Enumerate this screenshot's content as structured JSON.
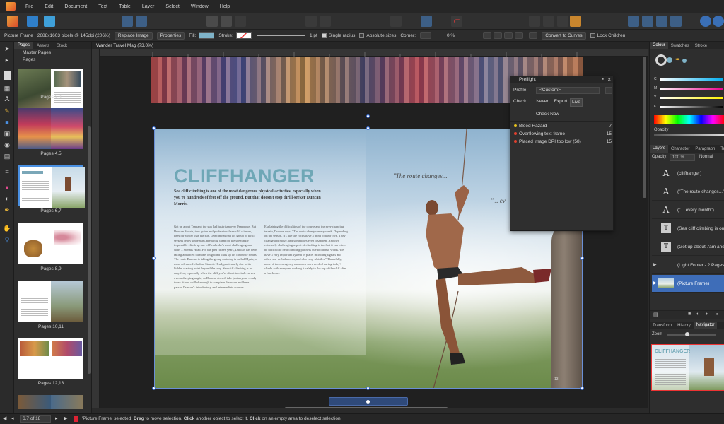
{
  "menu": [
    "File",
    "Edit",
    "Document",
    "Text",
    "Table",
    "Layer",
    "Select",
    "Window",
    "Help"
  ],
  "context_bar": {
    "selection_type": "Picture Frame",
    "image_info": "2688x1603 pixels @ 145dpi (206%)",
    "replace_image": "Replace Image",
    "properties": "Properties",
    "fill_label": "Fill:",
    "stroke_label": "Stroke:",
    "stroke_width": "1 pt",
    "single_radius": "Single radius",
    "absolute_sizes": "Absolute sizes",
    "corner_label": "Corner:",
    "corner_value": "0 %",
    "convert_to_curves": "Convert to Curves",
    "lock_children": "Lock Children",
    "fill_color": "#7fb3c8"
  },
  "pages_panel": {
    "tabs": [
      "Pages",
      "Assets",
      "Stock"
    ],
    "active_tab": "Pages",
    "master_pages": "Master Pages",
    "pages_section": "Pages",
    "spreads": [
      {
        "label": "Pages 2,3"
      },
      {
        "label": "Pages 4,5"
      },
      {
        "label": "Pages 6,7"
      },
      {
        "label": "Pages 8,9"
      },
      {
        "label": "Pages 10,11"
      },
      {
        "label": "Pages 12,13"
      }
    ]
  },
  "document": {
    "tab_title": "Wander Travel Mag (73.0%)",
    "headline": "CLIFFHANGER",
    "intro": "Sea cliff climbing is one of the most dangerous physical activities, especially when you're hundreds of feet off the ground. But that doesn't stop thrill-seeker Duncan Morris.",
    "quote1": "\"The route changes...",
    "quote2": "\"... ev",
    "body_col1": "Get up about 7am and the sun had just risen over Pembroke. But Duncan Morris, tour guide and professional sea cliff climber, rises far earlier than the sun. Duncan has had his group of thrill seekers ready since 6am, preparing them for the seemingly impossible climb up one of Pembroke's most challenging sea cliffs – Stennis Head. For the past fifteen years, Duncan has been taking advanced climbers on guided tours up his favourite routes. The route Duncan is taking the group on today is called Mysta, a more advanced climb at Stennis Head, particularly due to its hidden starting point beyond the crag. Sea cliff climbing is no easy feat, especially when the cliff you're about to climb curves over a dizzying angle, so Duncan doesn't take just anyone – only those fit and skilled enough to complete the route and have passed Duncan's introductory and intermediate courses.",
    "body_col2": "Explaining the difficulties of the course and the ever-changing terrain, Duncan says: \"The route changes every week. Depending on the season, it's like the rocks have a mind of their own. They change and move, and sometimes even disappear. Another extremely challenging aspect of climbing is the fact it can often be difficult to hear climbing partners due to intense winds. We have a very important system in place, including signals and other non-verbal moves, and also easy whistles.\" Thankfully, none of the emergency measures were needed during today's climb, with everyone making it safely to the top of the cliff after a few hours.",
    "page_num": "13"
  },
  "preflight": {
    "title": "Preflight",
    "profile_label": "Profile:",
    "profile_value": "<Custom>",
    "check_label": "Check:",
    "check_options": [
      "Never",
      "Export",
      "Live"
    ],
    "check_now": "Check Now",
    "items": [
      {
        "label": "Bleed Hazard",
        "count": "7",
        "color": "#e6c21d"
      },
      {
        "label": "Overflowing text frame",
        "count": "15",
        "color": "#e0402e"
      },
      {
        "label": "Placed image DPI too low (58)",
        "count": "15",
        "color": "#e0402e"
      }
    ]
  },
  "color_panel": {
    "tabs": [
      "Colour",
      "Swatches",
      "Stroke"
    ],
    "active_tab": "Colour",
    "opacity_label": "Opacity",
    "channels": [
      "C",
      "M",
      "Y",
      "K"
    ]
  },
  "layers_panel": {
    "tabs": [
      "Layers",
      "Character",
      "Paragraph",
      "Te"
    ],
    "active_tab": "Layers",
    "opacity_label": "Opacity:",
    "opacity_value": "100 %",
    "blend_mode": "Normal",
    "layers": [
      {
        "name": "(cliffhanger)",
        "icon": "A"
      },
      {
        "name": "(\"The route changes...\")",
        "icon": "A"
      },
      {
        "name": "(\"... every month\")",
        "icon": "A"
      },
      {
        "name": "(Sea cliff climbing is one",
        "icon": "T"
      },
      {
        "name": "(Get up about 7am and",
        "icon": "T"
      },
      {
        "name": "(Light Footer - 2 Pages)",
        "icon": ""
      },
      {
        "name": "(Picture Frame)",
        "icon": "img"
      }
    ]
  },
  "navigator_panel": {
    "tabs": [
      "Transform",
      "History",
      "Navigator"
    ],
    "active_tab": "Navigator",
    "zoom_label": "Zoom",
    "thumb_title": "CLIFFHANGER"
  },
  "status_bar": {
    "page_indicator": "6,7 of 18",
    "message_parts": [
      "'Picture Frame' selected. ",
      "Drag",
      " to move selection. ",
      "Click",
      " another object to select it. ",
      "Click",
      " on an empty area to deselect selection."
    ]
  }
}
